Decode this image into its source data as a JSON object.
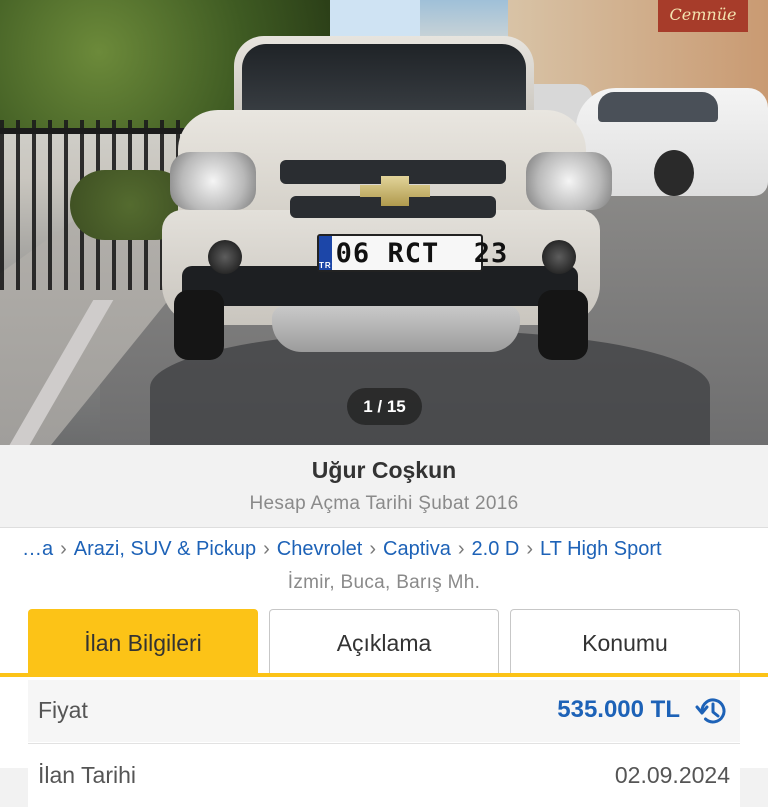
{
  "gallery": {
    "counter": "1 / 15",
    "plate_text": "06 RCT  23",
    "plate_country": "TR",
    "shop_sign": "Cemnüe"
  },
  "seller": {
    "name": "Uğur Coşkun",
    "account_date": "Hesap Açma Tarihi Şubat 2016"
  },
  "breadcrumb": {
    "items": [
      "…a",
      "Arazi, SUV & Pickup",
      "Chevrolet",
      "Captiva",
      "2.0 D",
      "LT High Sport"
    ],
    "separator": "›"
  },
  "location": "İzmir, Buca, Barış Mh.",
  "tabs": [
    {
      "label": "İlan Bilgileri",
      "active": true
    },
    {
      "label": "Açıklama",
      "active": false
    },
    {
      "label": "Konumu",
      "active": false
    }
  ],
  "details": {
    "price_label": "Fiyat",
    "price_value": "535.000 TL",
    "date_label": "İlan Tarihi",
    "date_value": "02.09.2024"
  },
  "icons": {
    "price_history": "history-icon"
  },
  "colors": {
    "accent_yellow": "#fcc317",
    "link_blue": "#1d62b7"
  }
}
